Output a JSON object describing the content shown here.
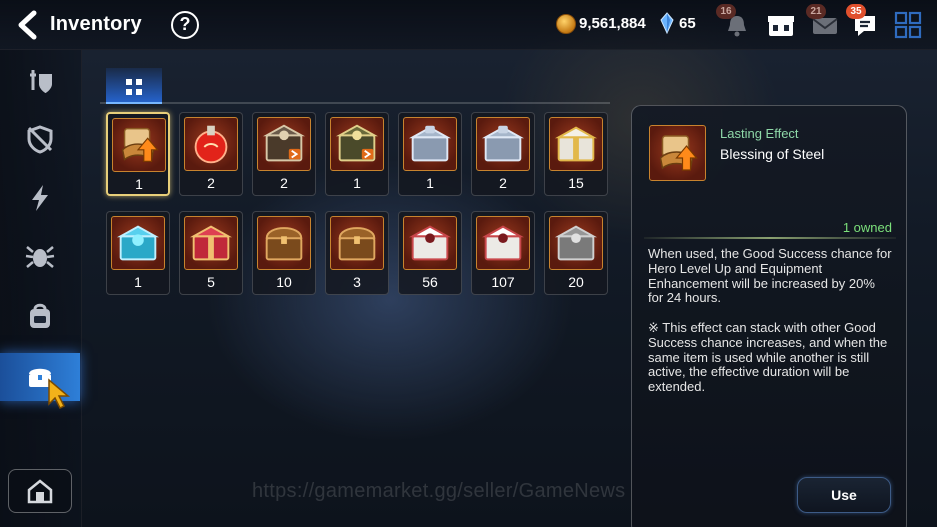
{
  "header": {
    "title": "Inventory",
    "help_label": "?",
    "gold": "9,561,884",
    "crystals": "65",
    "badges": {
      "alerts": "16",
      "mail": "21",
      "chat": "35"
    }
  },
  "sidebar": {
    "items": [
      {
        "icon": "armor-icon"
      },
      {
        "icon": "shield-off-icon"
      },
      {
        "icon": "lightning-icon"
      },
      {
        "icon": "spider-icon"
      },
      {
        "icon": "backpack-icon"
      },
      {
        "icon": "treasure-chest-icon",
        "active": true
      }
    ],
    "camp_icon": "camp-icon"
  },
  "filter_tab": {
    "icon": "grid-icon"
  },
  "items": [
    {
      "name": "Blessing of Steel",
      "qty": "1",
      "kind": "scroll",
      "selected": true
    },
    {
      "name": "",
      "qty": "2",
      "kind": "potion"
    },
    {
      "name": "",
      "qty": "2",
      "kind": "gear-box"
    },
    {
      "name": "",
      "qty": "1",
      "kind": "gear-box-gold"
    },
    {
      "name": "",
      "qty": "1",
      "kind": "silver-box"
    },
    {
      "name": "",
      "qty": "2",
      "kind": "silver-box"
    },
    {
      "name": "",
      "qty": "15",
      "kind": "white-gold-box"
    },
    {
      "name": "",
      "qty": "1",
      "kind": "cyan-box"
    },
    {
      "name": "",
      "qty": "5",
      "kind": "red-box"
    },
    {
      "name": "",
      "qty": "10",
      "kind": "wood-chest"
    },
    {
      "name": "",
      "qty": "3",
      "kind": "wood-chest"
    },
    {
      "name": "",
      "qty": "56",
      "kind": "white-red-box"
    },
    {
      "name": "",
      "qty": "107",
      "kind": "white-red-box"
    },
    {
      "name": "",
      "qty": "20",
      "kind": "grey-box"
    }
  ],
  "detail": {
    "type": "Lasting Effect",
    "name": "Blessing of Steel",
    "owned": "1 owned",
    "description": "When used, the Good Success chance for Hero Level Up and Equipment Enhancement will be increased by 20% for 24 hours.",
    "note": "※ This effect can stack with other Good Success chance increases, and when the same item is used while another is still active, the effective duration will be extended.",
    "use_label": "Use"
  },
  "watermark": "https://gamemarket.gg/seller/GameNews",
  "colors": {
    "accent": "#2e7fd8",
    "owned": "#7be07b",
    "effect_type": "#8fd8a8",
    "selected_border": "#e8cf7a"
  }
}
